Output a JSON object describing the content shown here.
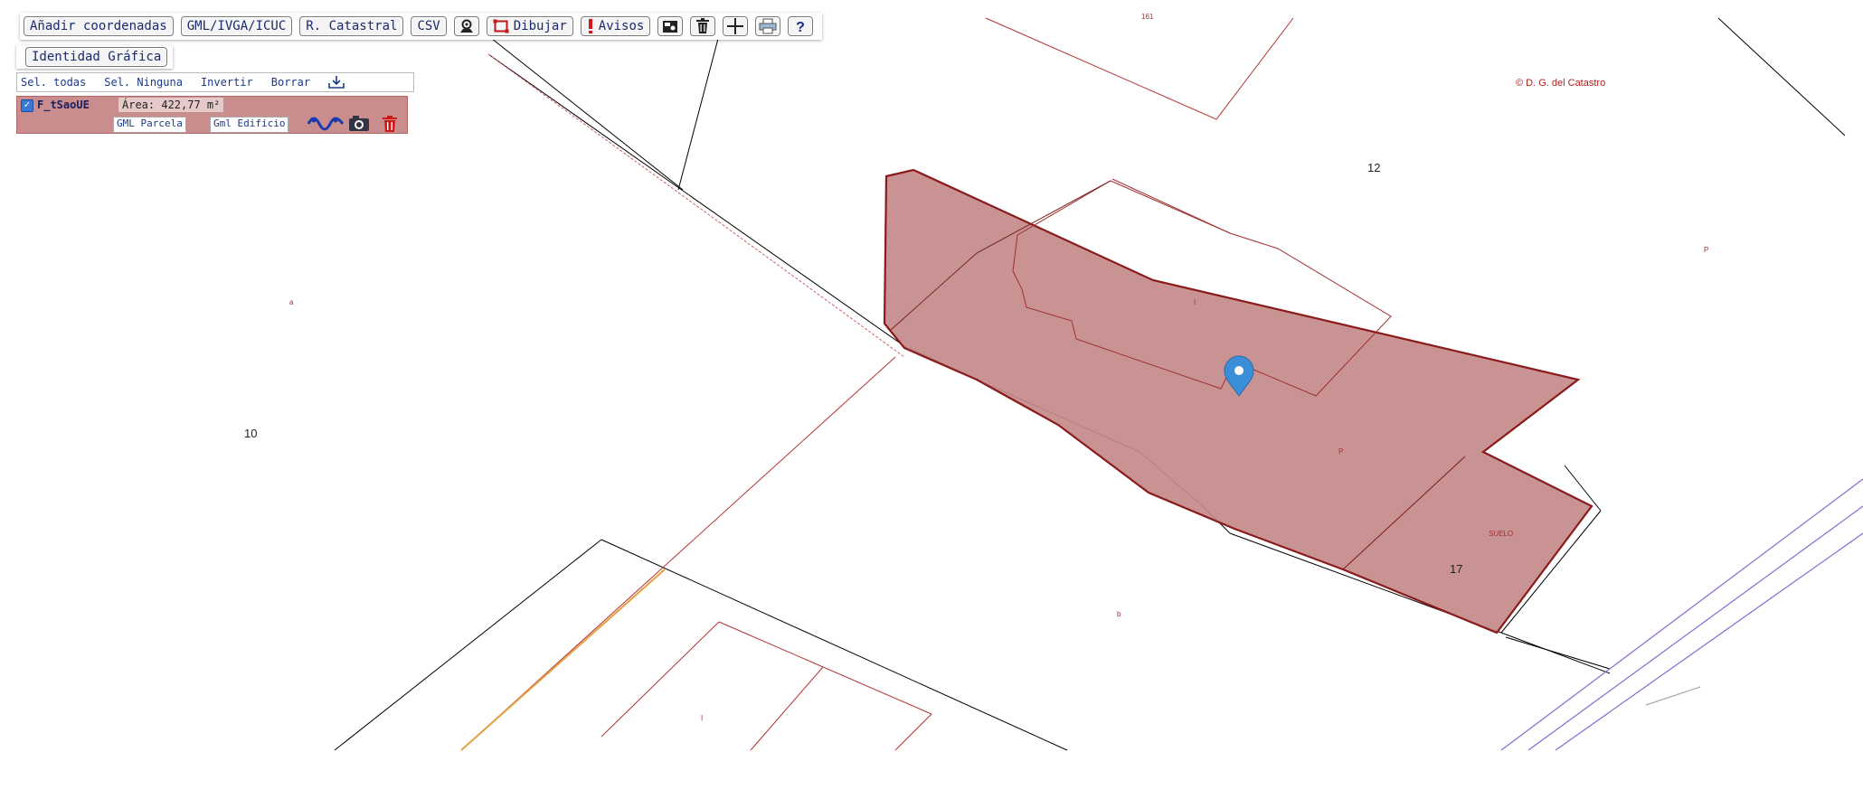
{
  "toolbar": {
    "add_coords": "Añadir coordenadas",
    "gml": "GML/IVGA/ICUC",
    "ref_catastral": "R. Catastral",
    "csv": "CSV",
    "draw": "Dibujar",
    "alerts": "Avisos",
    "icons": [
      "locate-pin-icon",
      "draw-rectangle-icon",
      "alert-icon",
      "export-icon",
      "trash-icon",
      "crosshair-icon",
      "print-icon",
      "help-icon"
    ]
  },
  "identity": {
    "label": "Identidad Gráfica"
  },
  "selection": {
    "select_all": "Sel. todas",
    "select_none": "Sel. Ninguna",
    "invert": "Invertir",
    "delete": "Borrar"
  },
  "layer": {
    "checked": true,
    "name": "F_tSaoUE",
    "area": "Área: 422,77 m²",
    "gml_parcel": "GML Parcela",
    "gml_building": "Gml Edificio",
    "icons": [
      "route-icon",
      "camera-icon",
      "delete-icon"
    ],
    "fill_color": "#c98d8d"
  },
  "map": {
    "copyright": "© D. G. del Catastro",
    "parcel_fill": "#c48a8a",
    "parcel_stroke": "#8b1a1a",
    "labels": {
      "n12": "12",
      "n10": "10",
      "n17": "17",
      "suelo": "SUELO",
      "l_a": "a",
      "l_b": "b",
      "l_p": "P",
      "l_p2": "P",
      "l_i": "I",
      "l_i2": "I",
      "top": "161"
    }
  }
}
